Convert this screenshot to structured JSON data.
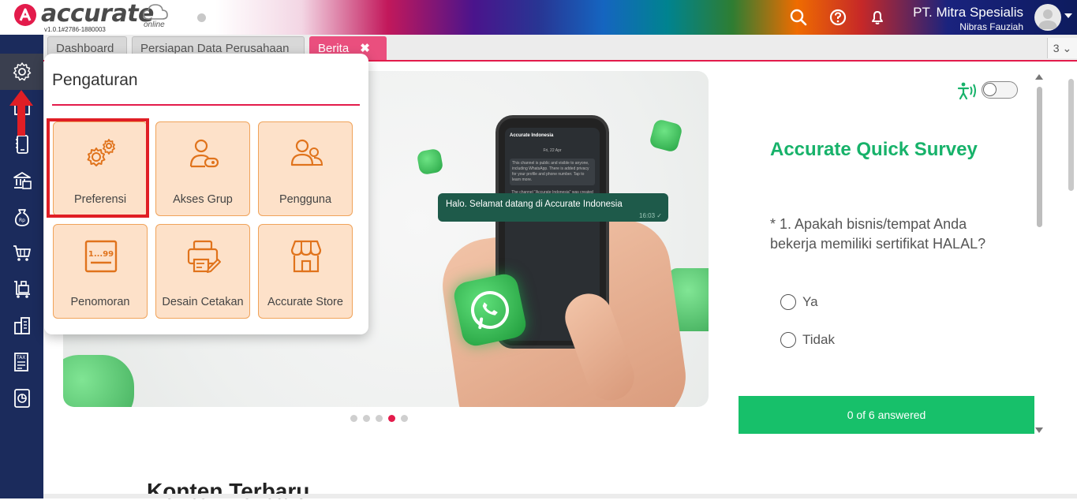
{
  "app": {
    "logo_text": "accurate",
    "logo_sub": "online",
    "version": "v1.0.1#2786-1880003"
  },
  "header": {
    "company": "PT. Mitra Spesialis",
    "user": "Nibras Fauziah"
  },
  "tabs": [
    {
      "label": "Dashboard"
    },
    {
      "label": "Persiapan Data Perusahaan"
    },
    {
      "label": "Berita"
    }
  ],
  "tab_close": "✖",
  "tab_count": "3 ⌄",
  "popup": {
    "title": "Pengaturan",
    "tiles": [
      {
        "label": "Preferensi",
        "icon": "gears-icon"
      },
      {
        "label": "Akses Grup",
        "icon": "user-key-icon"
      },
      {
        "label": "Pengguna",
        "icon": "users-icon"
      },
      {
        "label": "Penomoran",
        "icon": "numbering-icon"
      },
      {
        "label": "Desain Cetakan",
        "icon": "print-design-icon"
      },
      {
        "label": "Accurate Store",
        "icon": "store-icon"
      }
    ],
    "number_glyph": "1...99"
  },
  "banner": {
    "chat_message": "Halo. Selamat datang di Accurate Indonesia",
    "chat_time": "16:03 ✓",
    "phone_header": "Accurate Indonesia",
    "phone_lines": [
      "Fri, 22 Apr",
      "This channel is public and visible to anyone, including WhatsApp. There is added privacy for your profile and phone number. Tap to learn more.",
      "The channel \"Accurate Indonesia\" was created"
    ],
    "slide_count": 5,
    "active_slide": 4
  },
  "survey": {
    "title": "Accurate Quick Survey",
    "question": "* 1. Apakah bisnis/tempat Anda bekerja memiliki sertifikat HALAL?",
    "options": [
      "Ya",
      "Tidak"
    ],
    "progress": "0 of 6 answered"
  },
  "section": {
    "title": "Konten Terbaru"
  },
  "colors": {
    "brand_red": "#e31b4b",
    "sidebar": "#1b2b5c",
    "survey_green": "#17b26a",
    "tile_bg": "#fde1c9",
    "tile_icon": "#e0731c"
  }
}
